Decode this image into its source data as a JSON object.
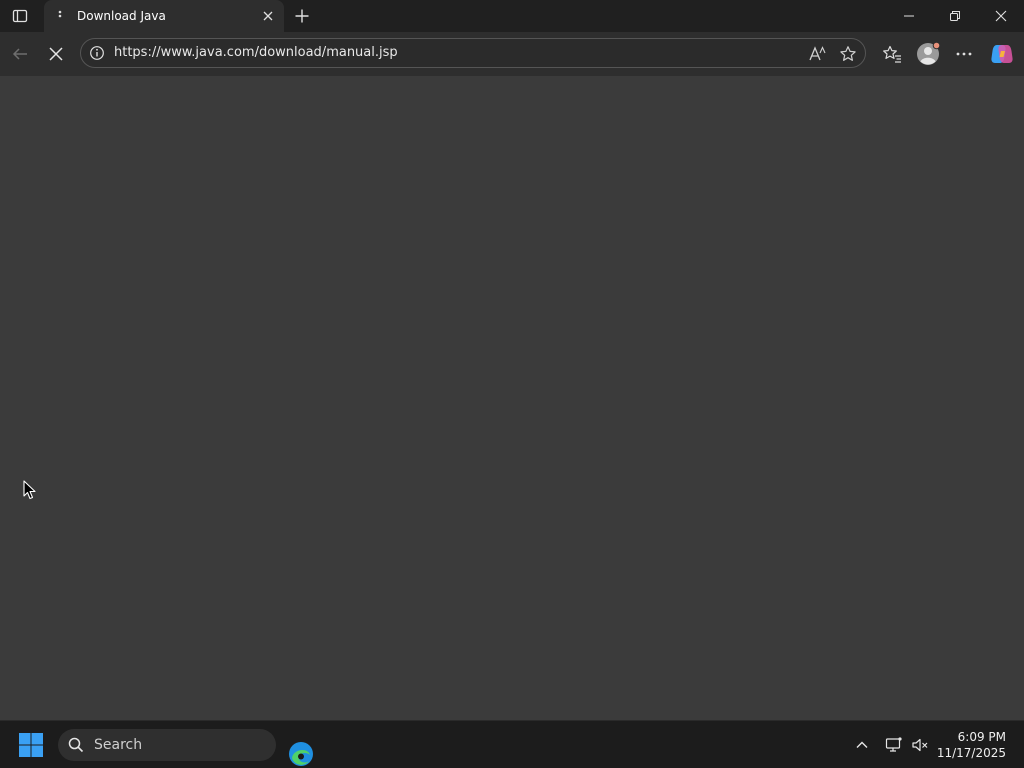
{
  "browser": {
    "tab": {
      "title": "Download Java",
      "loading": true
    },
    "address_bar": {
      "url": "https://www.java.com/download/manual.jsp"
    }
  },
  "icons": {
    "tab_actions": "tab-actions-icon",
    "tab_close": "close-icon",
    "new_tab": "plus-icon",
    "minimize": "minimize-icon",
    "restore": "restore-icon",
    "close_window": "close-icon",
    "back": "arrow-left-icon",
    "stop": "stop-loading-icon",
    "site_info": "info-icon",
    "read_aloud": "read-aloud-icon",
    "favorite": "star-icon",
    "favorites": "favorites-icon",
    "profile": "profile-icon",
    "more": "more-icon",
    "copilot": "copilot-icon"
  },
  "taskbar": {
    "search_label": "Search",
    "clock": {
      "time": "6:09 PM",
      "date": "11/17/2025"
    }
  },
  "colors": {
    "content_bg": "#3b3b3b",
    "toolbar_bg": "#2e2e2e",
    "titlebar_bg": "#202020",
    "taskbar_bg": "#1c1c1c",
    "windows_blue": "#3aa0f3"
  }
}
